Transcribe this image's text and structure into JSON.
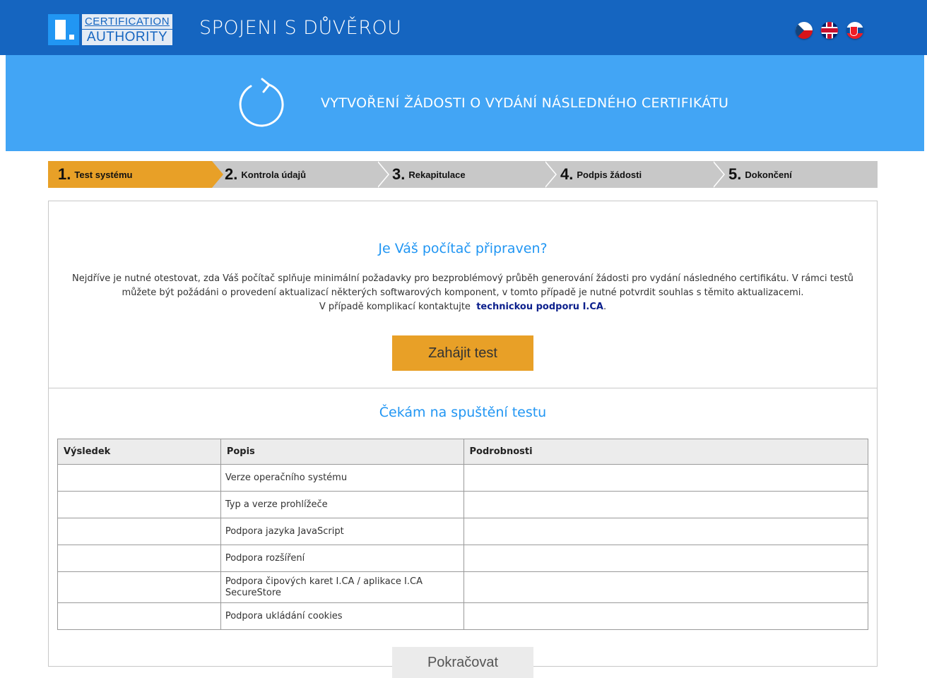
{
  "header": {
    "logo_line1": "CERTIFICATION",
    "logo_line2": "AUTHORITY",
    "title": "SPOJENI S DŮVĚROU",
    "languages": [
      "cz-flag-icon",
      "uk-flag-icon",
      "sk-flag-icon"
    ]
  },
  "banner": {
    "icon": "refresh-icon",
    "title": "VYTVOŘENÍ ŽÁDOSTI O VYDÁNÍ NÁSLEDNÉHO CERTIFIKÁTU"
  },
  "steps": [
    {
      "num": "1.",
      "label": "Test systému",
      "active": true
    },
    {
      "num": "2.",
      "label": "Kontrola údajů"
    },
    {
      "num": "3.",
      "label": "Rekapitulace"
    },
    {
      "num": "4.",
      "label": "Podpis žádosti"
    },
    {
      "num": "5.",
      "label": "Dokončení"
    }
  ],
  "test_section": {
    "heading": "Je Váš počítač připraven?",
    "intro_text": "Nejdříve je nutné otestovat, zda Váš počítač splňuje minimální požadavky pro bezproblémový průběh generování žádosti pro vydání následného certifikátu. V rámci testů můžete být požádáni o provedení aktualizací některých softwarových komponent, v tomto případě je nutné potvrdit souhlas s těmito aktualizacemi.",
    "contact_prefix": "V případě komplikací kontaktujte",
    "contact_link": "technickou podporu I.CA",
    "contact_suffix": ".",
    "start_button": "Zahájit test"
  },
  "results": {
    "heading": "Čekám na spuštění testu",
    "columns": [
      "Výsledek",
      "Popis",
      "Podrobnosti"
    ],
    "rows": [
      {
        "result": "",
        "description": "Verze operačního systému",
        "details": ""
      },
      {
        "result": "",
        "description": "Typ a verze prohlížeče",
        "details": ""
      },
      {
        "result": "",
        "description": "Podpora jazyka JavaScript",
        "details": ""
      },
      {
        "result": "",
        "description": "Podpora rozšíření",
        "details": ""
      },
      {
        "result": "",
        "description": "Podpora čipových karet I.CA / aplikace I.CA SecureStore",
        "details": ""
      },
      {
        "result": "",
        "description": "Podpora ukládání cookies",
        "details": ""
      }
    ]
  },
  "continue_button": "Pokračovat",
  "colors": {
    "header_bg": "#1565c0",
    "banner_bg": "#42a5f5",
    "accent_orange": "#e8a027",
    "heading_blue": "#2196f3",
    "link_navy": "#0b1f8c"
  }
}
